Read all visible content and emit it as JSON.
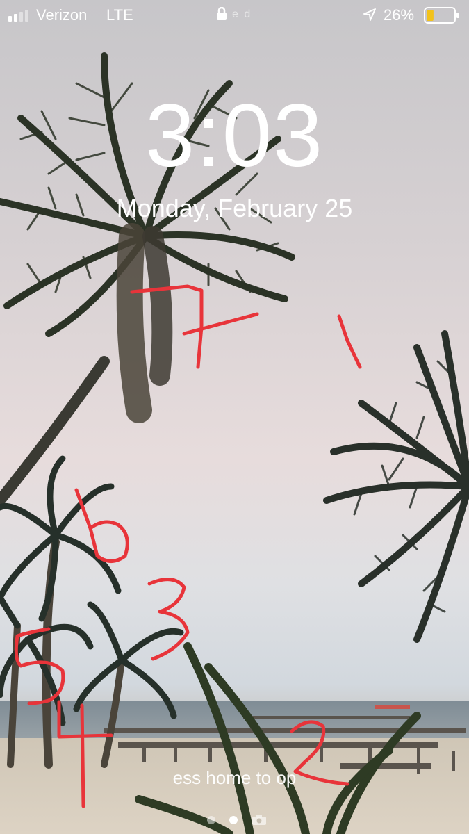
{
  "status_bar": {
    "carrier": "Verizon",
    "network": "LTE",
    "extra_text": "e d",
    "battery_percent": "26%",
    "battery_level": 0.26,
    "signal_bars_active": 2,
    "icons": [
      "signal-icon",
      "lock-icon",
      "location-icon",
      "battery-icon"
    ]
  },
  "lock_screen": {
    "time": "3:03",
    "date": "Monday, February 25",
    "unlock_hint": "ess home to op",
    "page_indicator": {
      "pages": 2,
      "active": 1,
      "extra_icon": "camera-icon"
    }
  },
  "annotations": {
    "color": "#e8343a",
    "numbers": [
      "7",
      "1",
      "6",
      "3",
      "5",
      "4",
      "2"
    ]
  },
  "colors": {
    "sky_top": "#c7c6c9",
    "sky_mid": "#e7dcdc",
    "palm": "#2b3326",
    "battery_fill": "#f2c21b"
  }
}
